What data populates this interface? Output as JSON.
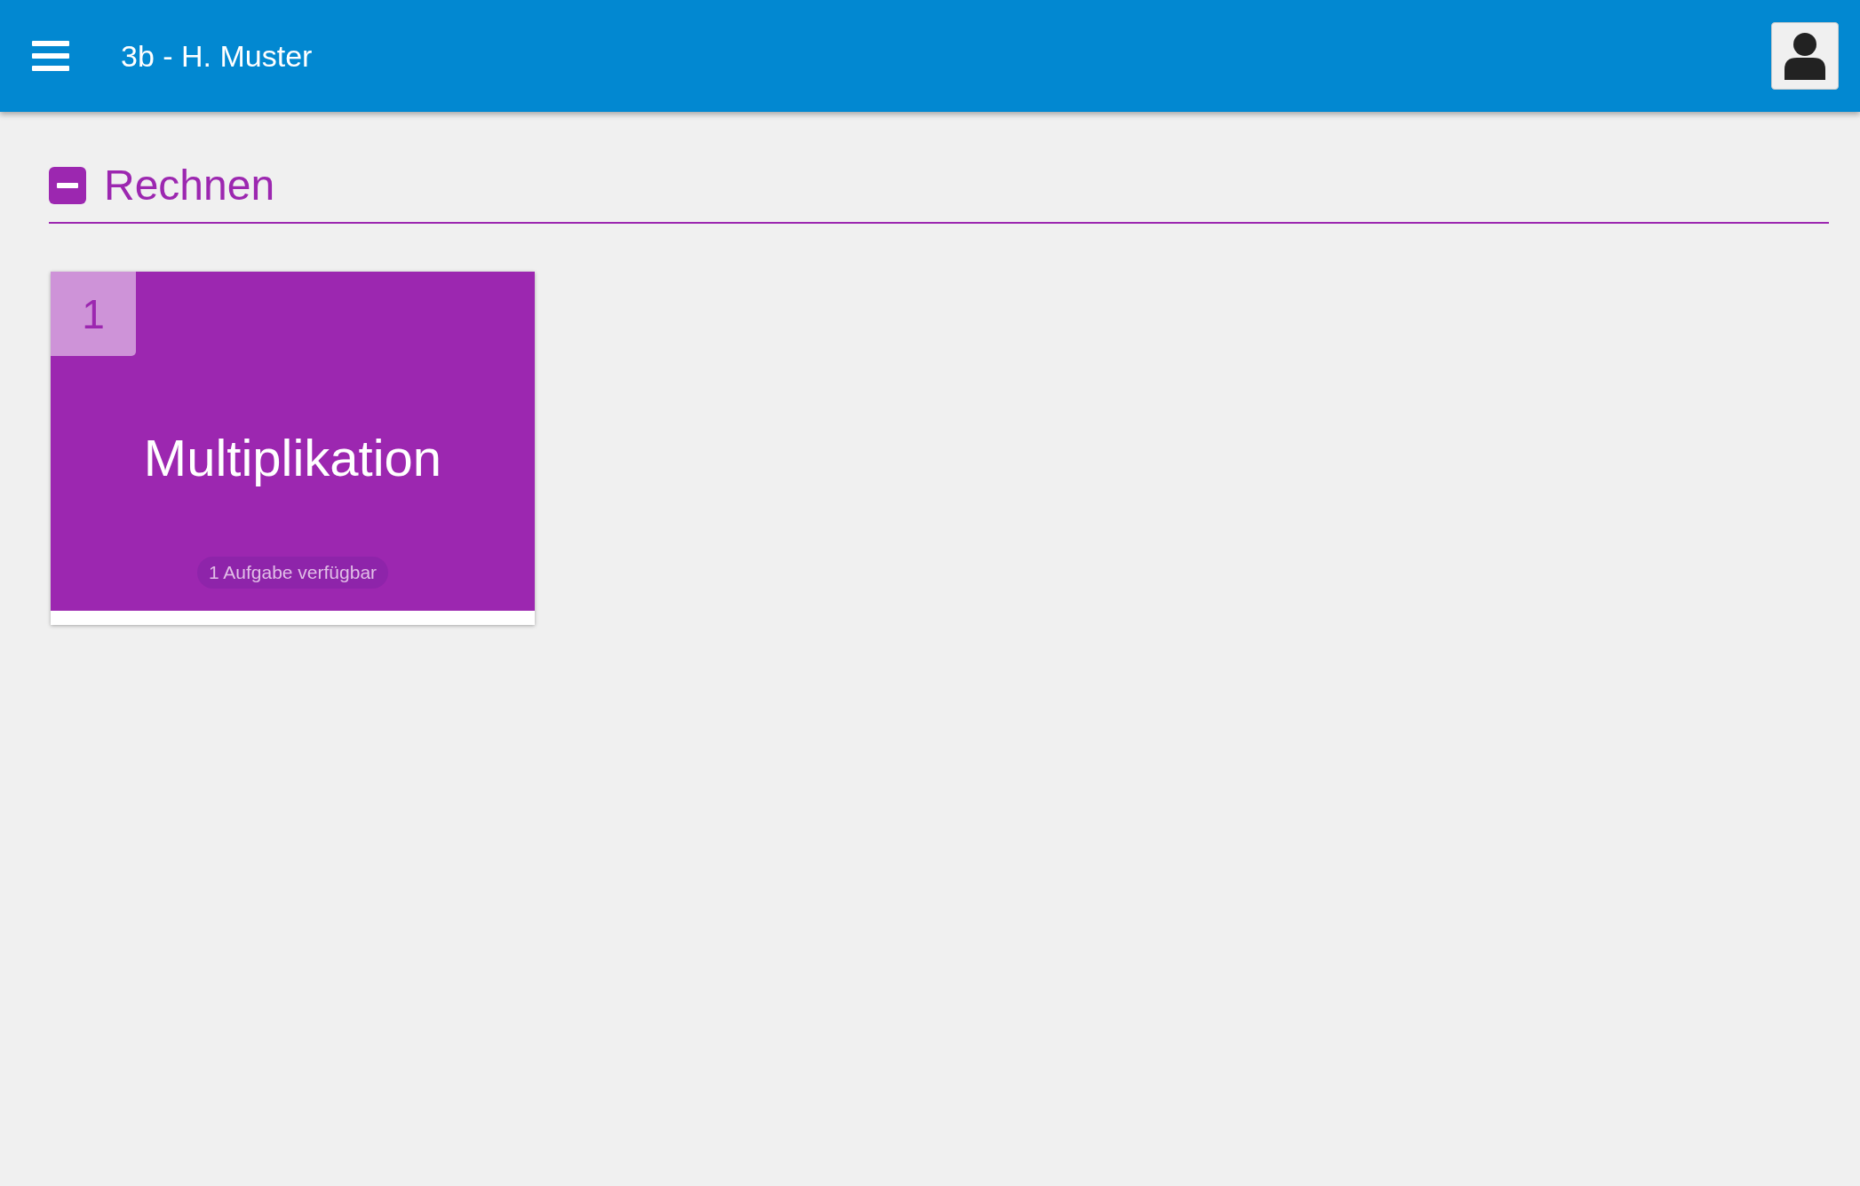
{
  "header": {
    "title": "3b - H. Muster"
  },
  "sections": [
    {
      "title": "Rechnen",
      "expanded": true,
      "cards": [
        {
          "number": "1",
          "title": "Multiplikation",
          "badge": "1 Aufgabe verfügbar"
        }
      ]
    }
  ]
}
